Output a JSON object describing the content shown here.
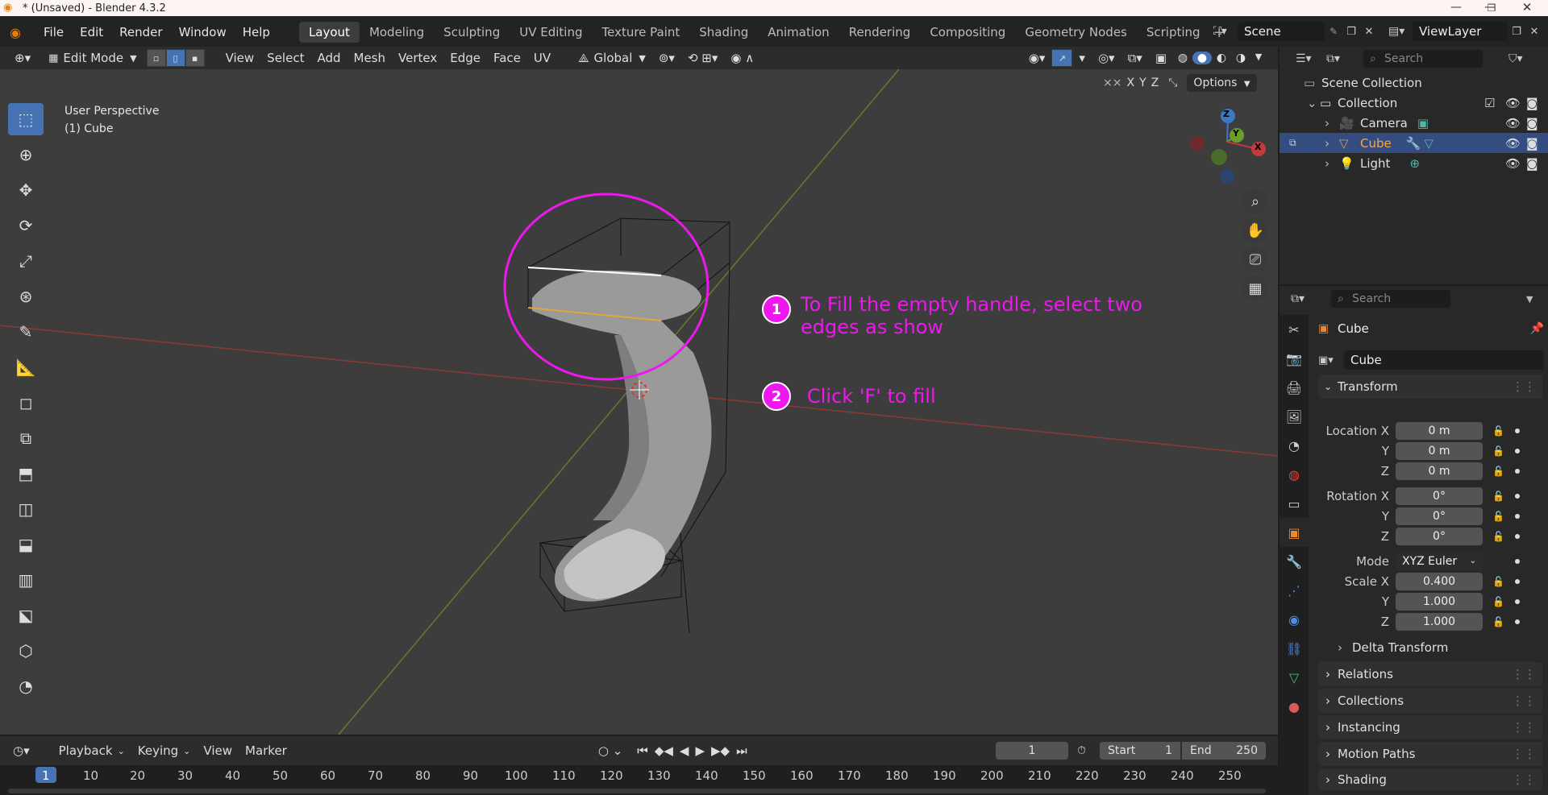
{
  "window": {
    "title": "* (Unsaved) - Blender 4.3.2"
  },
  "menus": [
    "File",
    "Edit",
    "Render",
    "Window",
    "Help"
  ],
  "workspace_tabs": [
    {
      "label": "Layout",
      "active": true
    },
    {
      "label": "Modeling",
      "active": false
    },
    {
      "label": "Sculpting",
      "active": false
    },
    {
      "label": "UV Editing",
      "active": false
    },
    {
      "label": "Texture Paint",
      "active": false
    },
    {
      "label": "Shading",
      "active": false
    },
    {
      "label": "Animation",
      "active": false
    },
    {
      "label": "Rendering",
      "active": false
    },
    {
      "label": "Compositing",
      "active": false
    },
    {
      "label": "Geometry Nodes",
      "active": false
    },
    {
      "label": "Scripting",
      "active": false
    }
  ],
  "scene": {
    "name": "Scene",
    "view_layer": "ViewLayer"
  },
  "viewport_header": {
    "mode": "Edit Mode",
    "menus": [
      "View",
      "Select",
      "Add",
      "Mesh",
      "Vertex",
      "Edge",
      "Face",
      "UV"
    ],
    "orientation": "Global",
    "options_label": "Options",
    "axis_labels": [
      "X",
      "Y",
      "Z"
    ]
  },
  "viewport": {
    "perspective": "User Perspective",
    "object_label": "(1) Cube",
    "gizmo_axes": {
      "x": "X",
      "y": "Y",
      "z": "Z"
    }
  },
  "annotations": [
    {
      "num": "1",
      "lines": [
        "To Fill the empty handle, select two",
        "edges as show"
      ]
    },
    {
      "num": "2",
      "lines": [
        "Click 'F' to fill"
      ]
    }
  ],
  "outliner": {
    "search_placeholder": "Search",
    "rows": [
      {
        "label": "Scene Collection"
      },
      {
        "label": "Collection"
      },
      {
        "label": "Camera"
      },
      {
        "label": "Cube",
        "selected": true
      },
      {
        "label": "Light"
      }
    ]
  },
  "properties": {
    "search_placeholder": "Search",
    "object_name": "Cube",
    "data_name": "Cube",
    "transform_label": "Transform",
    "location": {
      "label": "Location X",
      "x": "0 m",
      "y": "0 m",
      "z": "0 m"
    },
    "rotation": {
      "label": "Rotation X",
      "x": "0°",
      "y": "0°",
      "z": "0°"
    },
    "mode_label": "Mode",
    "mode_value": "XYZ Euler",
    "scale": {
      "label": "Scale X",
      "x": "0.400",
      "y": "1.000",
      "z": "1.000"
    },
    "axis_y": "Y",
    "axis_z": "Z",
    "panels": [
      "Delta Transform",
      "Relations",
      "Collections",
      "Instancing",
      "Motion Paths",
      "Shading"
    ]
  },
  "timeline": {
    "menus": [
      "Playback",
      "Keying",
      "View",
      "Marker"
    ],
    "current_frame": "1",
    "start_label": "Start",
    "start": "1",
    "end_label": "End",
    "end": "250",
    "ticks": [
      "1",
      "10",
      "20",
      "30",
      "40",
      "50",
      "60",
      "70",
      "80",
      "90",
      "100",
      "110",
      "120",
      "130",
      "140",
      "150",
      "160",
      "170",
      "180",
      "190",
      "200",
      "210",
      "220",
      "230",
      "240",
      "250"
    ]
  },
  "colors": {
    "accent": "#4772b3",
    "annotation": "#ee18ee",
    "selection_row": "#334d80",
    "x_axis": "#c4393c",
    "y_axis": "#6d9c2e",
    "z_axis": "#3c78c4"
  }
}
